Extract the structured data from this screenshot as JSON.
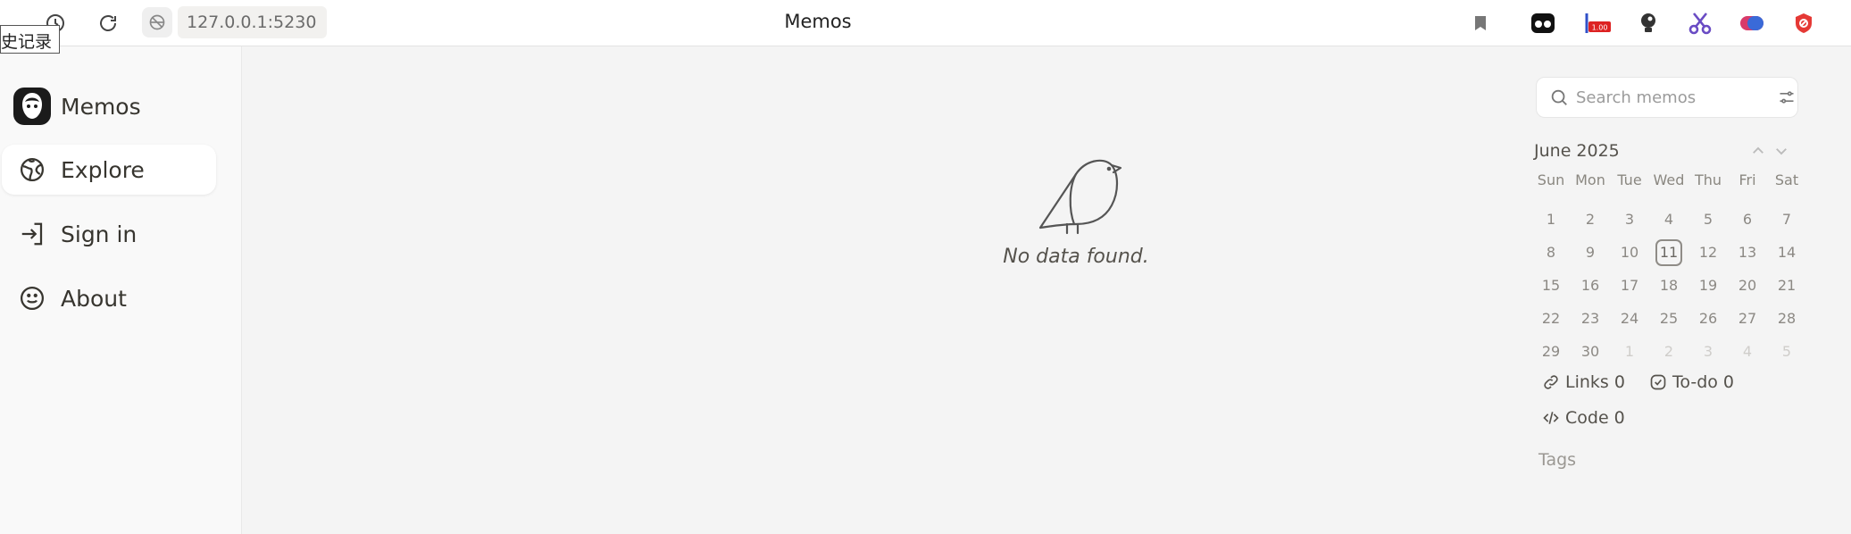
{
  "browser": {
    "tooltip": "史记录",
    "url": "127.0.0.1:5230",
    "tab_title": "Memos",
    "extension_badge": "1.00"
  },
  "sidebar": {
    "items": [
      {
        "label": "Memos",
        "icon": "memos-logo-icon"
      },
      {
        "label": "Explore",
        "icon": "globe-icon",
        "active": true
      },
      {
        "label": "Sign in",
        "icon": "sign-in-icon"
      },
      {
        "label": "About",
        "icon": "smile-icon"
      }
    ]
  },
  "main": {
    "empty_text": "No data found."
  },
  "search": {
    "placeholder": "Search memos"
  },
  "calendar": {
    "month": "June 2025",
    "weekdays": [
      "Sun",
      "Mon",
      "Tue",
      "Wed",
      "Thu",
      "Fri",
      "Sat"
    ],
    "days": [
      "1",
      "2",
      "3",
      "4",
      "5",
      "6",
      "7",
      "8",
      "9",
      "10",
      "11",
      "12",
      "13",
      "14",
      "15",
      "16",
      "17",
      "18",
      "19",
      "20",
      "21",
      "22",
      "23",
      "24",
      "25",
      "26",
      "27",
      "28",
      "29",
      "30",
      "1",
      "2",
      "3",
      "4",
      "5"
    ],
    "today": "11"
  },
  "stats": {
    "links": "Links 0",
    "todo": "To-do 0",
    "code": "Code 0"
  },
  "tags": {
    "label": "Tags"
  },
  "colors": {
    "background": "#f4f4f4",
    "sidebar": "#f9f9f9",
    "text": "#37352f",
    "muted": "#8c8984"
  }
}
